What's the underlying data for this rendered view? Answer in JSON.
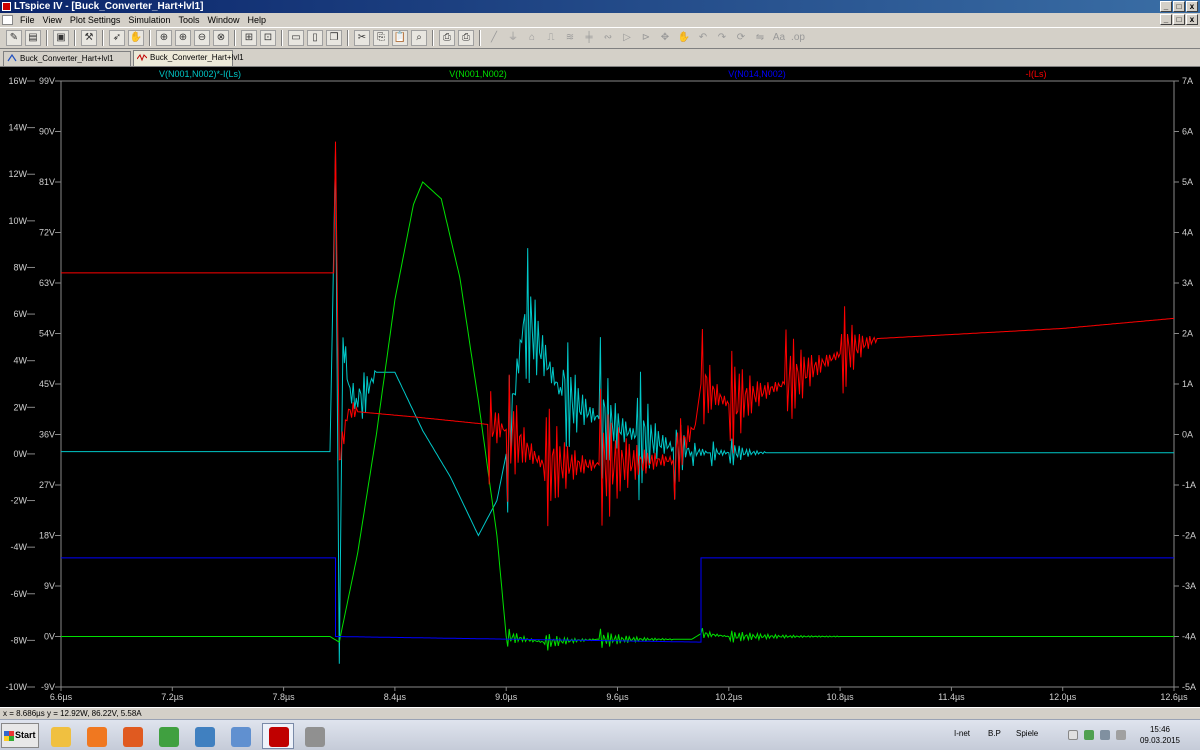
{
  "window": {
    "title": "LTspice IV - [Buck_Converter_Hart+lvl1]"
  },
  "menu": [
    "File",
    "View",
    "Plot Settings",
    "Simulation",
    "Tools",
    "Window",
    "Help"
  ],
  "tabs": [
    {
      "label": "Buck_Converter_Hart+lvl1",
      "icon": "schematic-icon"
    },
    {
      "label": "Buck_Converter_Hart+lvl1",
      "icon": "waveform-icon",
      "active": true
    }
  ],
  "traces": [
    {
      "label": "V(N001,N002)*-I(Ls)",
      "color": "#00c8c8"
    },
    {
      "label": "V(N001,N002)",
      "color": "#00e000"
    },
    {
      "label": "V(N014,N002)",
      "color": "#0000ff"
    },
    {
      "label": "-I(Ls)",
      "color": "#ff0000"
    }
  ],
  "chart_data": {
    "type": "line",
    "x_label_ticks": [
      "6.6µs",
      "7.2µs",
      "7.8µs",
      "8.4µs",
      "9.0µs",
      "9.6µs",
      "10.2µs",
      "10.8µs",
      "11.4µs",
      "12.0µs",
      "12.6µs"
    ],
    "y_ticks_power": [
      "16W",
      "14W",
      "12W",
      "10W",
      "8W",
      "6W",
      "4W",
      "2W",
      "0W",
      "-2W",
      "-4W",
      "-6W",
      "-8W",
      "-10W"
    ],
    "y_ticks_voltage": [
      "99V",
      "90V",
      "81V",
      "72V",
      "63V",
      "54V",
      "45V",
      "36V",
      "27V",
      "18V",
      "9V",
      "0V",
      "-9V"
    ],
    "y_ticks_current": [
      "7A",
      "6A",
      "5A",
      "4A",
      "3A",
      "2A",
      "1A",
      "0A",
      "-1A",
      "-2A",
      "-3A",
      "-4A",
      "-5A"
    ],
    "xlim": [
      6.6,
      12.6
    ],
    "x_unit": "µs",
    "ylim_power": [
      -10,
      16
    ],
    "ylim_voltage": [
      -9,
      99
    ],
    "ylim_current": [
      -5,
      7
    ],
    "grid": false,
    "series": [
      {
        "name": "V(N001,N002)*-I(Ls)",
        "axis": "power",
        "x": [
          6.6,
          7.8,
          8.05,
          8.08,
          8.1,
          8.12,
          8.15,
          8.2,
          8.3,
          8.4,
          8.55,
          8.7,
          8.85,
          8.95,
          9.0,
          9.1,
          9.3,
          9.5,
          9.7,
          9.9,
          10.0,
          10.1,
          10.2,
          10.4,
          10.8,
          11.4,
          12.0,
          12.6
        ],
        "y": [
          0.1,
          0.1,
          0.1,
          13.0,
          -9.0,
          5.0,
          3.0,
          2.0,
          3.5,
          3.5,
          1.0,
          -1.0,
          -3.5,
          -2.0,
          0.0,
          6.0,
          2.5,
          1.5,
          0.8,
          0.3,
          0.1,
          0.05,
          0.05,
          0.05,
          0.05,
          0.05,
          0.05,
          0.05
        ]
      },
      {
        "name": "V(N001,N002)",
        "axis": "voltage",
        "x": [
          6.6,
          8.05,
          8.1,
          8.2,
          8.3,
          8.4,
          8.5,
          8.55,
          8.65,
          8.75,
          8.85,
          8.95,
          9.0,
          9.2,
          9.5,
          9.9,
          10.0,
          10.05,
          10.2,
          10.8,
          12.6
        ],
        "y": [
          0,
          0,
          -1,
          15,
          36,
          60,
          77,
          81,
          78,
          64,
          42,
          18,
          0,
          -1,
          -0.5,
          -0.5,
          -0.5,
          0.5,
          0,
          0,
          0
        ]
      },
      {
        "name": "V(N014,N002)",
        "axis": "voltage",
        "x": [
          6.6,
          8.08,
          8.08,
          10.05,
          10.05,
          12.6
        ],
        "y": [
          14,
          14,
          0,
          -1,
          14,
          14
        ]
      },
      {
        "name": "-I(Ls)",
        "axis": "current",
        "x": [
          6.6,
          8.07,
          8.08,
          8.1,
          8.15,
          8.2,
          8.5,
          8.9,
          9.0,
          9.2,
          9.5,
          9.9,
          10.02,
          10.05,
          10.2,
          10.5,
          10.8,
          11.0,
          12.0,
          12.6
        ],
        "y": [
          3.2,
          3.2,
          5.8,
          -0.5,
          0.5,
          0.45,
          0.35,
          0.2,
          0.1,
          -0.6,
          -0.6,
          -0.5,
          0.2,
          1.0,
          0.6,
          1.0,
          1.6,
          1.9,
          2.1,
          2.3
        ]
      }
    ]
  },
  "status": {
    "cursor": "x = 8.686µs    y = 12.92W, 86.22V, 5.58A"
  },
  "taskbar": {
    "start_label": "Start",
    "apps": [
      {
        "name": "explorer-icon",
        "color": "#f0c040"
      },
      {
        "name": "media-player-icon",
        "color": "#f07820"
      },
      {
        "name": "firefox-icon",
        "color": "#e05a20"
      },
      {
        "name": "shield-app-icon",
        "color": "#40a040"
      },
      {
        "name": "remote-desktop-icon",
        "color": "#4080c0"
      },
      {
        "name": "image-viewer-icon",
        "color": "#6090d0"
      },
      {
        "name": "ltspice-icon",
        "color": "#c00000"
      },
      {
        "name": "tools-icon",
        "color": "#909090"
      }
    ],
    "tray_labels": [
      "I-net",
      "B.P",
      "Spiele"
    ],
    "time": "15:46",
    "date": "09.03.2015"
  }
}
